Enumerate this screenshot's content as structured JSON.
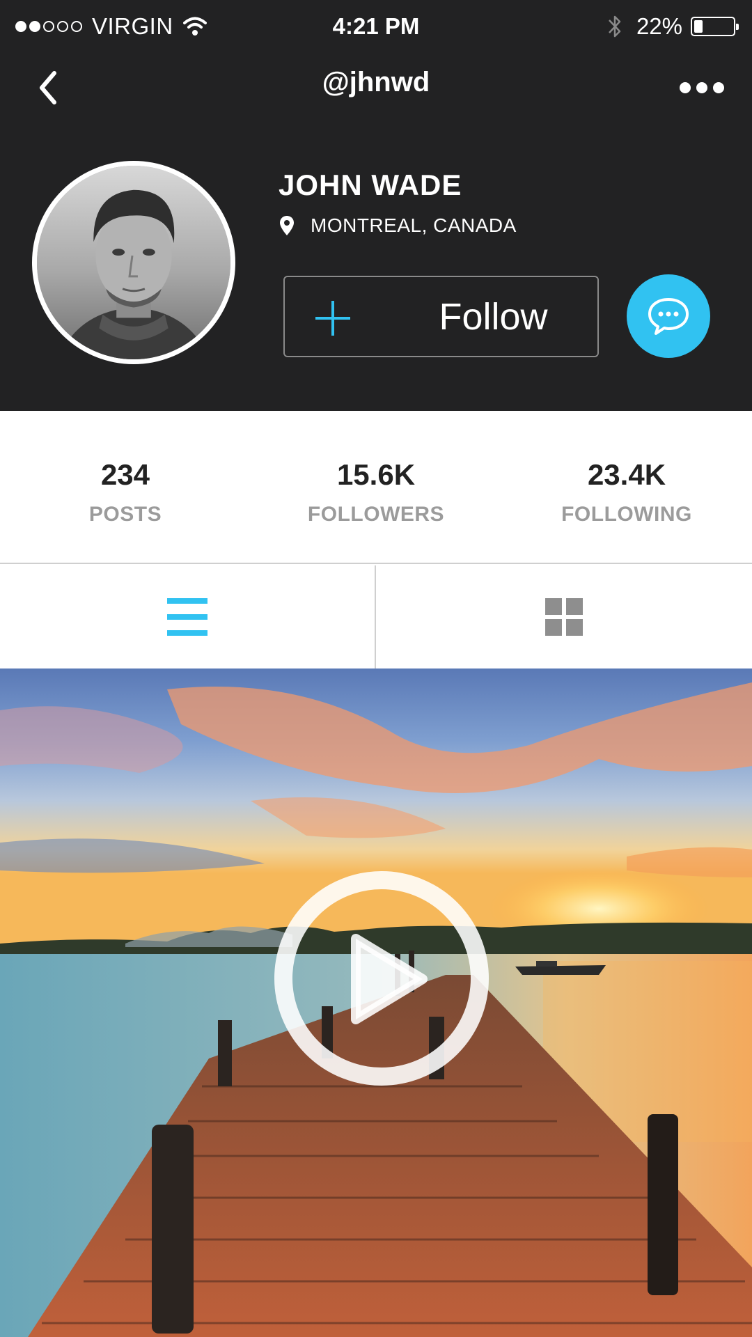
{
  "status_bar": {
    "carrier": "VIRGIN",
    "signal_bars": 2,
    "signal_total": 5,
    "time": "4:21 PM",
    "battery_percent": "22%",
    "battery_level": 0.22,
    "icons": [
      "wifi-icon",
      "bluetooth-icon",
      "battery-icon"
    ]
  },
  "navbar": {
    "title": "@jhnwd",
    "icons": [
      "back-chevron-icon",
      "more-dots-icon"
    ]
  },
  "profile": {
    "name": "JOHN WADE",
    "location": "MONTREAL, CANADA",
    "follow_label": "Follow",
    "icons": [
      "location-pin-icon",
      "plus-icon",
      "chat-bubble-icon"
    ]
  },
  "stats": [
    {
      "value": "234",
      "label": "POSTS"
    },
    {
      "value": "15.6K",
      "label": "FOLLOWERS"
    },
    {
      "value": "23.4K",
      "label": "FOLLOWING"
    }
  ],
  "view_toggle": {
    "selected": "list",
    "icons": [
      "list-view-icon",
      "grid-view-icon"
    ]
  },
  "post": {
    "media": "video",
    "icons": [
      "play-icon"
    ]
  },
  "colors": {
    "header_bg": "#222223",
    "accent": "#31c2f1",
    "stat_value": "#222222",
    "stat_label": "#9b9b9b",
    "inactive_icon": "#8e8e8e"
  }
}
